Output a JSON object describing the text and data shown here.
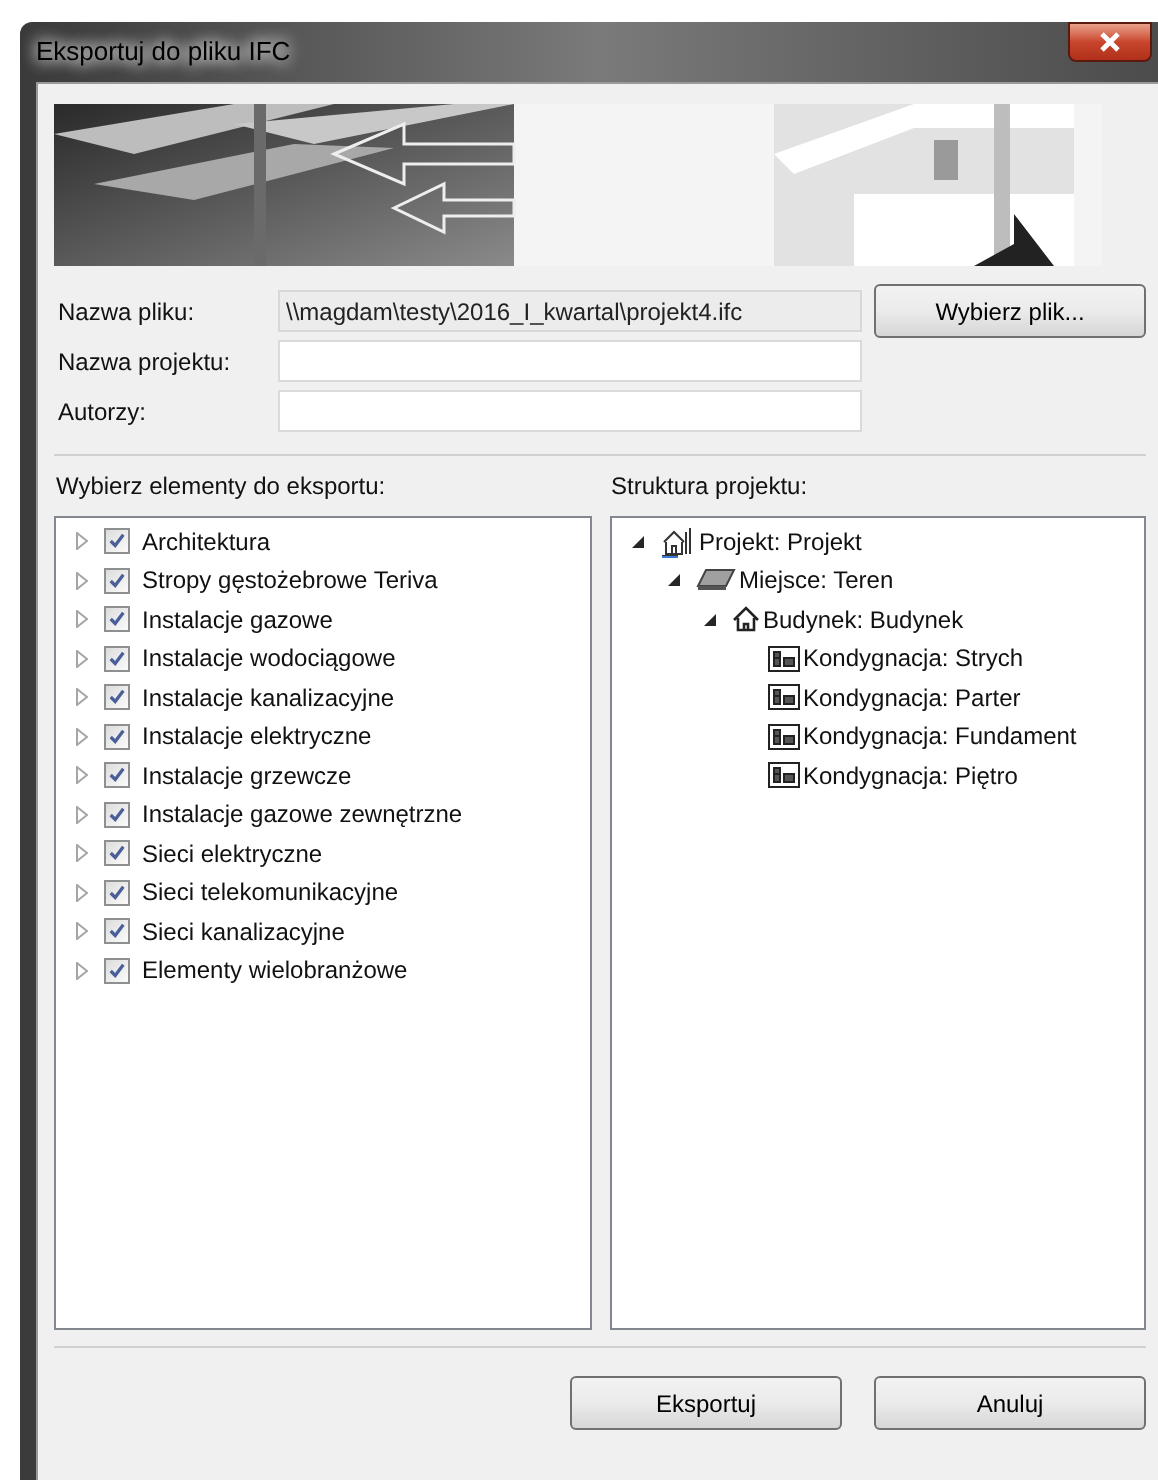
{
  "window": {
    "title": "Eksportuj do pliku IFC"
  },
  "banner": {
    "kind": "picture"
  },
  "fields": [
    {
      "label": "Nazwa pliku:",
      "value": "\\\\magdam\\testy\\2016_I_kwartal\\projekt4.ifc",
      "disabled": true
    },
    {
      "label": "Nazwa projektu:",
      "disabled": false
    },
    {
      "label": "Autorzy:",
      "disabled": false
    }
  ],
  "browse_button": "Wybierz plik...",
  "elements": {
    "label": "Wybierz elementy do eksportu:",
    "items": [
      {
        "label": "Architektura",
        "checked": true,
        "expanded": false
      },
      {
        "label": "Stropy gęstożebrowe Teriva",
        "checked": true,
        "expanded": false
      },
      {
        "label": "Instalacje gazowe",
        "checked": true,
        "expanded": false
      },
      {
        "label": "Instalacje wodociągowe",
        "checked": true,
        "expanded": false
      },
      {
        "label": "Instalacje kanalizacyjne",
        "checked": true,
        "expanded": false
      },
      {
        "label": "Instalacje elektryczne",
        "checked": true,
        "expanded": false
      },
      {
        "label": "Instalacje grzewcze",
        "checked": true,
        "expanded": false
      },
      {
        "label": "Instalacje gazowe zewnętrzne",
        "checked": true,
        "expanded": false
      },
      {
        "label": "Sieci elektryczne",
        "checked": true,
        "expanded": false
      },
      {
        "label": "Sieci telekomunikacyjne",
        "checked": true,
        "expanded": false
      },
      {
        "label": "Sieci kanalizacyjne",
        "checked": true,
        "expanded": false
      },
      {
        "label": "Elementy wielobranżowe",
        "checked": true,
        "expanded": false
      }
    ]
  },
  "structure": {
    "label": "Struktura projektu:",
    "tree": [
      {
        "kind": "project",
        "label": "Projekt: Projekt",
        "expanded": true,
        "children": [
          {
            "kind": "site",
            "label": "Miejsce: Teren",
            "expanded": true,
            "children": [
              {
                "kind": "building",
                "label": "Budynek: Budynek",
                "expanded": true,
                "children": [
                  {
                    "kind": "storey",
                    "label": "Kondygnacja: Strych"
                  },
                  {
                    "kind": "storey",
                    "label": "Kondygnacja: Parter"
                  },
                  {
                    "kind": "storey",
                    "label": "Kondygnacja: Fundament"
                  },
                  {
                    "kind": "storey",
                    "label": "Kondygnacja: Piętro"
                  }
                ]
              }
            ]
          }
        ]
      }
    ]
  },
  "buttons": [
    "Eksportuj",
    "Anuluj"
  ]
}
